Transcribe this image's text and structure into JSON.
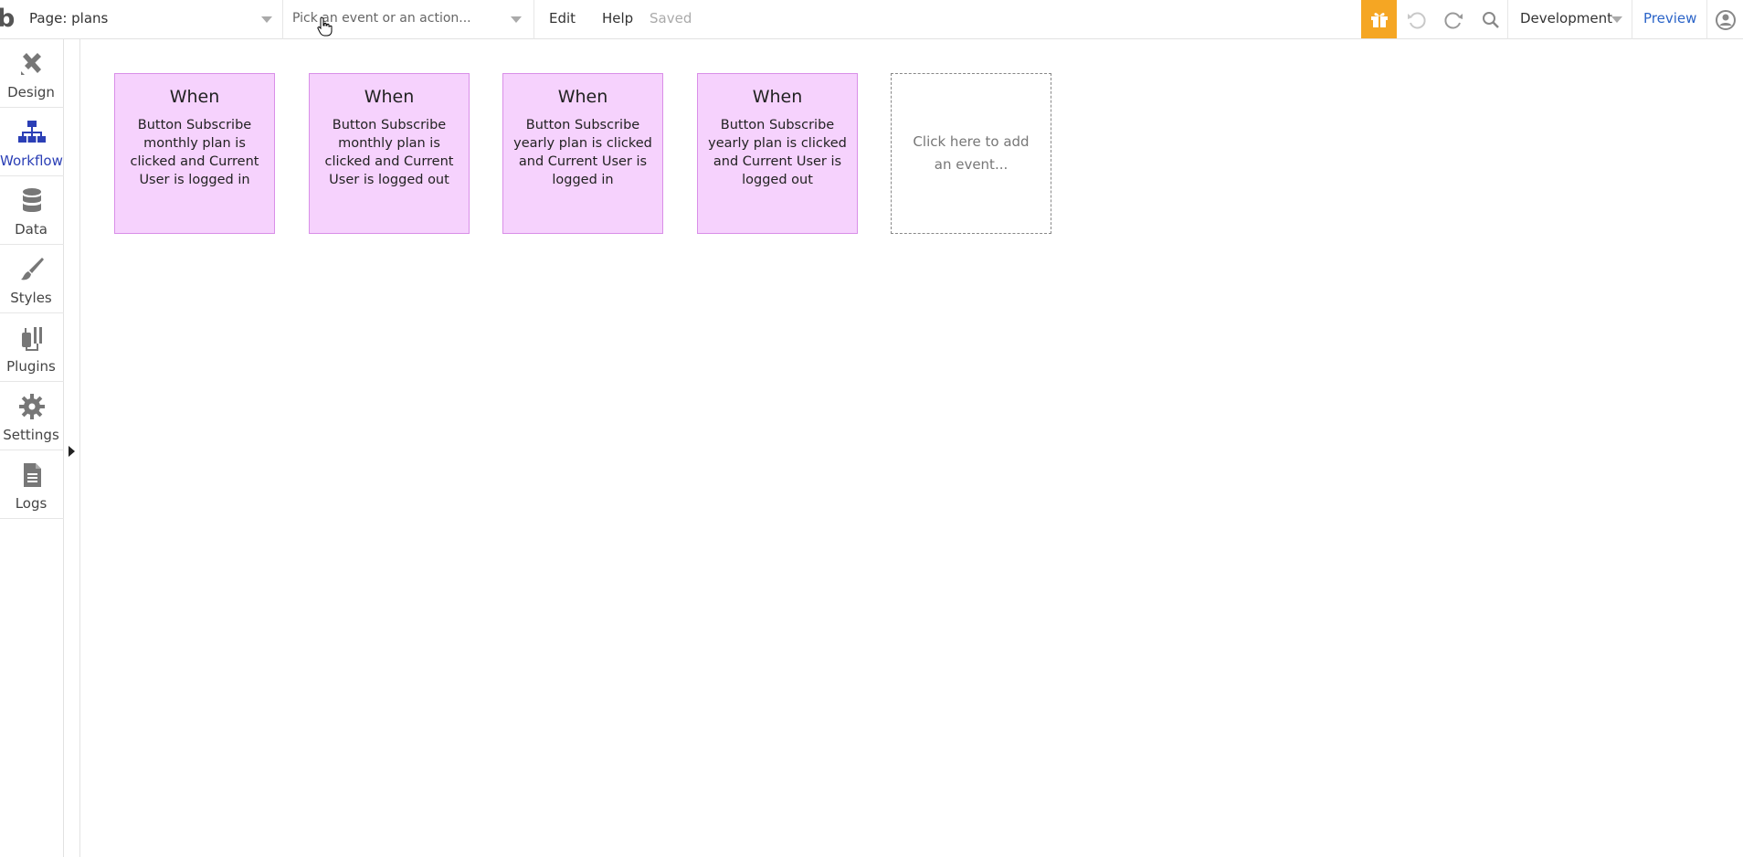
{
  "topbar": {
    "logo": "b",
    "page_selector": "Page: plans",
    "event_picker_placeholder": "Pick an event or an action...",
    "menu_edit": "Edit",
    "menu_help": "Help",
    "save_status": "Saved",
    "environment": "Development",
    "preview": "Preview"
  },
  "sidebar": {
    "items": [
      {
        "label": "Design",
        "icon": "design-icon"
      },
      {
        "label": "Workflow",
        "icon": "workflow-icon",
        "active": true
      },
      {
        "label": "Data",
        "icon": "database-icon"
      },
      {
        "label": "Styles",
        "icon": "brush-icon"
      },
      {
        "label": "Plugins",
        "icon": "plug-icon"
      },
      {
        "label": "Settings",
        "icon": "gear-icon"
      },
      {
        "label": "Logs",
        "icon": "document-icon"
      }
    ]
  },
  "events": [
    {
      "title": "When",
      "description": "Button Subscribe monthly plan is clicked and Current User is logged in"
    },
    {
      "title": "When",
      "description": "Button Subscribe monthly plan is clicked and Current User is logged out"
    },
    {
      "title": "When",
      "description": "Button Subscribe yearly plan is clicked and Current User is logged in"
    },
    {
      "title": "When",
      "description": "Button Subscribe yearly plan is clicked and Current User is logged out"
    }
  ],
  "add_event": "Click here to add an event...",
  "colors": {
    "accent": "#f5a623",
    "link": "#2b64c8",
    "active_nav": "#2b3fb6",
    "event_card_bg": "#f6d2fd",
    "event_card_border": "#d98fe8"
  }
}
